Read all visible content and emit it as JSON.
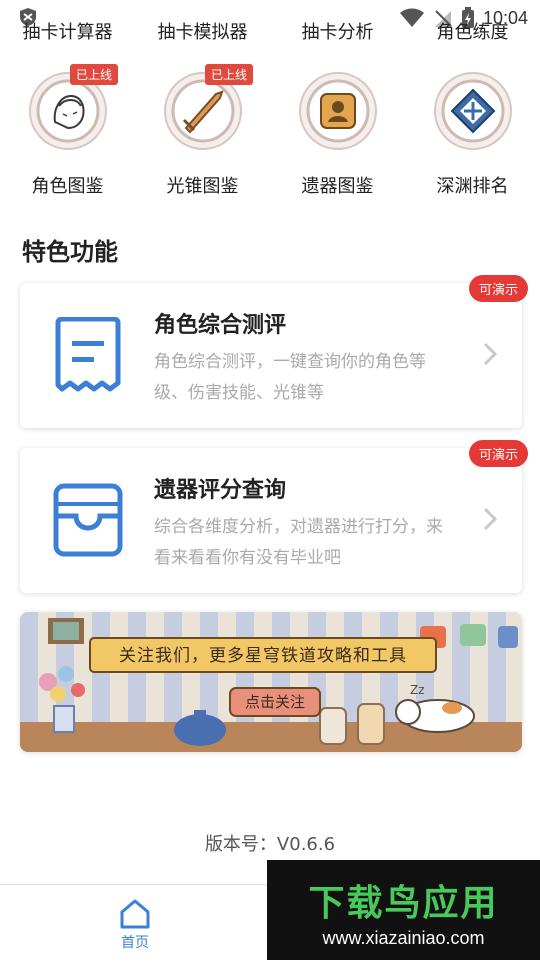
{
  "status_bar": {
    "time": "10:04"
  },
  "tools_row": {
    "items": [
      "抽卡计算器",
      "抽卡模拟器",
      "抽卡分析",
      "角色练度"
    ]
  },
  "icon_grid": {
    "items": [
      {
        "label": "角色图鉴",
        "badge": "已上线"
      },
      {
        "label": "光锥图鉴",
        "badge": "已上线"
      },
      {
        "label": "遗器图鉴",
        "badge": ""
      },
      {
        "label": "深渊排名",
        "badge": ""
      }
    ]
  },
  "section": {
    "title": "特色功能"
  },
  "cards": [
    {
      "title": "角色综合测评",
      "desc": "角色综合测评，一键查询你的角色等级、伤害技能、光锥等",
      "badge": "可演示"
    },
    {
      "title": "遗器评分查询",
      "desc": "综合各维度分析，对遗器进行打分，来看来看看你有没有毕业吧",
      "badge": "可演示"
    }
  ],
  "banner": {
    "text": "关注我们，更多星穹铁道攻略和工具",
    "button": "点击关注"
  },
  "version": "版本号：V0.6.6",
  "bottom_nav": {
    "home_label": "首页"
  },
  "watermark": {
    "title": "下载鸟应用",
    "url": "www.xiazainiao.com"
  },
  "colors": {
    "accent": "#3b7fd6",
    "badge_red": "#e53935",
    "icon_gold": "#c88a3c",
    "icon_ring": "#d6c7c0"
  }
}
